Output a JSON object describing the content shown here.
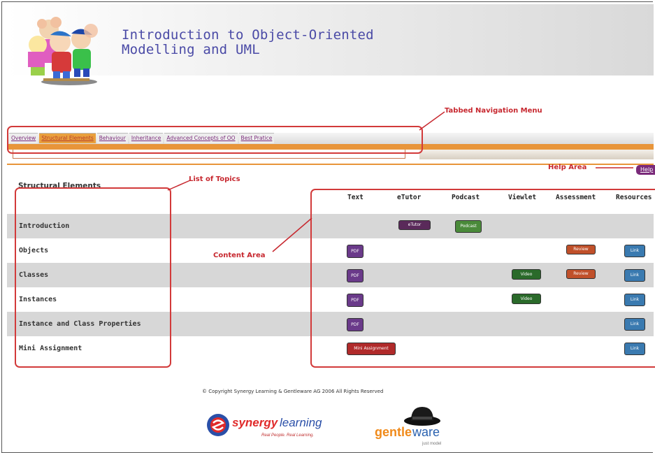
{
  "header": {
    "title_line1": "Introduction to Object-Oriented",
    "title_line2": "Modelling and UML"
  },
  "tabs": [
    {
      "label": "Overview",
      "active": false
    },
    {
      "label": "Structural Elements",
      "active": true
    },
    {
      "label": "Behaviour",
      "active": false
    },
    {
      "label": "Inheritance",
      "active": false
    },
    {
      "label": "Advanced Concepts of OO",
      "active": false
    },
    {
      "label": "Best Pratice",
      "active": false
    }
  ],
  "help": {
    "label": "Help"
  },
  "annotations": {
    "tabbed_nav": "Tabbed Navigation Menu",
    "list_topics": "List of Topics",
    "help_area": "Help Area",
    "content_area": "Content Area"
  },
  "section": {
    "title": "Structural Elements"
  },
  "columns": [
    "Text",
    "eTutor",
    "Podcast",
    "Viewlet",
    "Assessment",
    "Resources"
  ],
  "rows": [
    {
      "label": "Introduction",
      "shade": true,
      "items": [
        "",
        "etutor",
        "podcast",
        "",
        "",
        ""
      ]
    },
    {
      "label": "Objects",
      "shade": false,
      "items": [
        "pdf",
        "",
        "",
        "",
        "assess",
        "res"
      ]
    },
    {
      "label": "Classes",
      "shade": true,
      "items": [
        "pdf",
        "",
        "",
        "video",
        "assess",
        "res"
      ]
    },
    {
      "label": "Instances",
      "shade": false,
      "items": [
        "pdf",
        "",
        "",
        "video",
        "",
        "res"
      ]
    },
    {
      "label": "Instance and Class Properties",
      "shade": true,
      "items": [
        "pdf",
        "",
        "",
        "",
        "",
        "res"
      ]
    },
    {
      "label": "Mini Assignment",
      "shade": false,
      "items": [
        "mini",
        "",
        "",
        "",
        "",
        "res"
      ]
    }
  ],
  "badges": {
    "pdf": "PDF",
    "etutor": "eTutor",
    "podcast": "Podcast",
    "video": "Video",
    "assess": "Review",
    "res": "Link",
    "mini": "Mini Assignment"
  },
  "footer": {
    "copyright": "© Copyright Synergy Learning & Gentleware AG 2006 All Rights Reserved",
    "synergy_brand_bold": "synergy",
    "synergy_brand_light": "learning",
    "synergy_tagline": "Real People. Real Learning.",
    "gentle_brand_a": "gentle",
    "gentle_brand_b": "ware",
    "gentle_tagline": "just model"
  },
  "colors": {
    "accent_orange": "#e8953a",
    "annotation_red": "#c7282f",
    "tab_purple": "#7a2a7a",
    "title_blue": "#4a4aa6"
  }
}
